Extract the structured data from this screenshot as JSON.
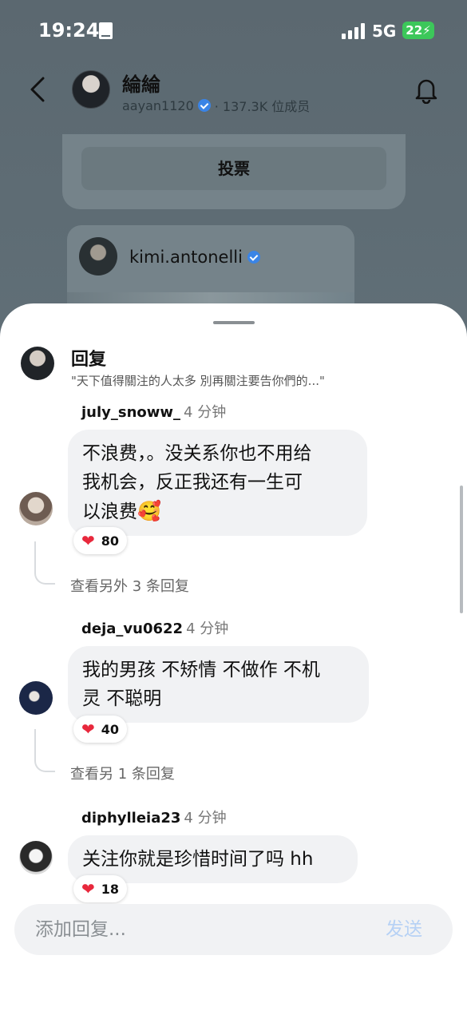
{
  "status_bar": {
    "time": "19:24",
    "network": "5G",
    "battery": "22"
  },
  "header": {
    "channel_name": "綸綸",
    "handle": "aayan1120",
    "members": "· 137.3K 位成员"
  },
  "vote_card": {
    "button_label": "投票"
  },
  "shared_post": {
    "username": "kimi.antonelli"
  },
  "reply_sheet": {
    "title": "回复",
    "quote": "\"天下值得關注的人太多 別再關注要告你們的...\"",
    "comments": [
      {
        "user": "july_snoww_",
        "time": "4 分钟",
        "lines": [
          "不浪费，。没关系你也不用给",
          "我机会，反正我还有一生可",
          "以浪费"
        ],
        "emoji": "🥰",
        "likes": "80",
        "more": "查看另外 3 条回复"
      },
      {
        "user": "deja_vu0622",
        "time": "4 分钟",
        "lines": [
          "我的男孩 不矫情 不做作 不机",
          "灵 不聪明"
        ],
        "likes": "40",
        "more": "查看另 1 条回复"
      },
      {
        "user": "diphylleia23",
        "time": "4 分钟",
        "lines": [
          "关注你就是珍惜时间了吗 hh"
        ],
        "likes": "18"
      }
    ],
    "composer_placeholder": "添加回复...",
    "send_label": "发送"
  },
  "colors": {
    "accent": "#3a84e6",
    "heart": "#e8283c",
    "send_disabled": "#b6d1f5",
    "battery": "#3cc75a"
  }
}
